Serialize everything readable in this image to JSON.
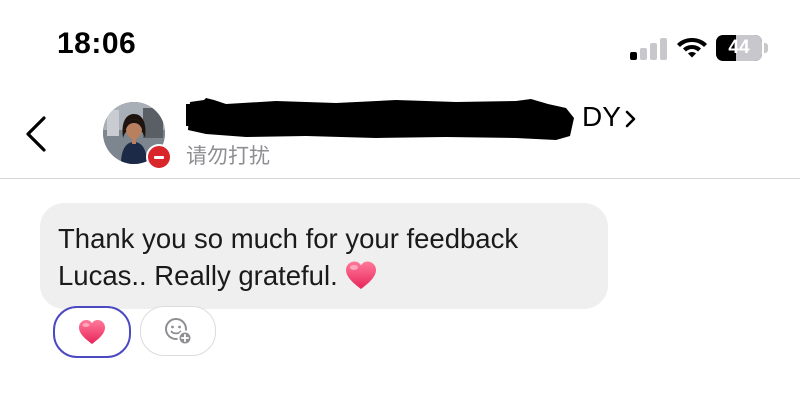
{
  "status_bar": {
    "time": "18:06",
    "battery_level": "44",
    "battery_fraction": 0.44,
    "signal_bars_active": 1,
    "signal_bars_total": 4,
    "icons": [
      "signal-icon",
      "wifi-icon",
      "battery-icon"
    ]
  },
  "header": {
    "back_icon": "chevron-left-icon",
    "contact_name": "DY",
    "contact_status": "请勿打扰",
    "status_badge_icon": "do-not-disturb-icon",
    "chevron_icon": "chevron-right-icon"
  },
  "messages": [
    {
      "text": "Thank you so much for your feedback Lucas.. Really grateful.",
      "emoji": "heart-emoji",
      "bubble_color": "#efefef"
    }
  ],
  "reactions": {
    "selected_emoji": "heart-emoji",
    "selected_border_color": "#4b4ac2",
    "add_icon": "add-reaction-icon"
  },
  "colors": {
    "heart_top": "#ff7a9a",
    "heart_bottom": "#e8245a",
    "badge_red": "#d9262b",
    "secondary_text": "#8e8e93"
  }
}
